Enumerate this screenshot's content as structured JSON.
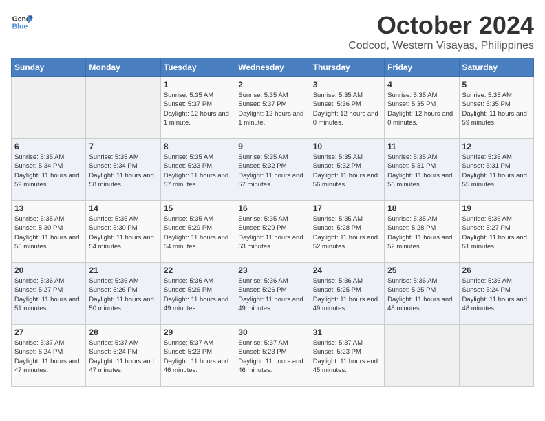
{
  "header": {
    "logo_line1": "General",
    "logo_line2": "Blue",
    "month": "October 2024",
    "location": "Codcod, Western Visayas, Philippines"
  },
  "days_of_week": [
    "Sunday",
    "Monday",
    "Tuesday",
    "Wednesday",
    "Thursday",
    "Friday",
    "Saturday"
  ],
  "weeks": [
    [
      {
        "day": "",
        "sunrise": "",
        "sunset": "",
        "daylight": "",
        "empty": true
      },
      {
        "day": "",
        "sunrise": "",
        "sunset": "",
        "daylight": "",
        "empty": true
      },
      {
        "day": "1",
        "sunrise": "Sunrise: 5:35 AM",
        "sunset": "Sunset: 5:37 PM",
        "daylight": "Daylight: 12 hours and 1 minute.",
        "empty": false
      },
      {
        "day": "2",
        "sunrise": "Sunrise: 5:35 AM",
        "sunset": "Sunset: 5:37 PM",
        "daylight": "Daylight: 12 hours and 1 minute.",
        "empty": false
      },
      {
        "day": "3",
        "sunrise": "Sunrise: 5:35 AM",
        "sunset": "Sunset: 5:36 PM",
        "daylight": "Daylight: 12 hours and 0 minutes.",
        "empty": false
      },
      {
        "day": "4",
        "sunrise": "Sunrise: 5:35 AM",
        "sunset": "Sunset: 5:35 PM",
        "daylight": "Daylight: 12 hours and 0 minutes.",
        "empty": false
      },
      {
        "day": "5",
        "sunrise": "Sunrise: 5:35 AM",
        "sunset": "Sunset: 5:35 PM",
        "daylight": "Daylight: 11 hours and 59 minutes.",
        "empty": false
      }
    ],
    [
      {
        "day": "6",
        "sunrise": "Sunrise: 5:35 AM",
        "sunset": "Sunset: 5:34 PM",
        "daylight": "Daylight: 11 hours and 59 minutes.",
        "empty": false
      },
      {
        "day": "7",
        "sunrise": "Sunrise: 5:35 AM",
        "sunset": "Sunset: 5:34 PM",
        "daylight": "Daylight: 11 hours and 58 minutes.",
        "empty": false
      },
      {
        "day": "8",
        "sunrise": "Sunrise: 5:35 AM",
        "sunset": "Sunset: 5:33 PM",
        "daylight": "Daylight: 11 hours and 57 minutes.",
        "empty": false
      },
      {
        "day": "9",
        "sunrise": "Sunrise: 5:35 AM",
        "sunset": "Sunset: 5:32 PM",
        "daylight": "Daylight: 11 hours and 57 minutes.",
        "empty": false
      },
      {
        "day": "10",
        "sunrise": "Sunrise: 5:35 AM",
        "sunset": "Sunset: 5:32 PM",
        "daylight": "Daylight: 11 hours and 56 minutes.",
        "empty": false
      },
      {
        "day": "11",
        "sunrise": "Sunrise: 5:35 AM",
        "sunset": "Sunset: 5:31 PM",
        "daylight": "Daylight: 11 hours and 56 minutes.",
        "empty": false
      },
      {
        "day": "12",
        "sunrise": "Sunrise: 5:35 AM",
        "sunset": "Sunset: 5:31 PM",
        "daylight": "Daylight: 11 hours and 55 minutes.",
        "empty": false
      }
    ],
    [
      {
        "day": "13",
        "sunrise": "Sunrise: 5:35 AM",
        "sunset": "Sunset: 5:30 PM",
        "daylight": "Daylight: 11 hours and 55 minutes.",
        "empty": false
      },
      {
        "day": "14",
        "sunrise": "Sunrise: 5:35 AM",
        "sunset": "Sunset: 5:30 PM",
        "daylight": "Daylight: 11 hours and 54 minutes.",
        "empty": false
      },
      {
        "day": "15",
        "sunrise": "Sunrise: 5:35 AM",
        "sunset": "Sunset: 5:29 PM",
        "daylight": "Daylight: 11 hours and 54 minutes.",
        "empty": false
      },
      {
        "day": "16",
        "sunrise": "Sunrise: 5:35 AM",
        "sunset": "Sunset: 5:29 PM",
        "daylight": "Daylight: 11 hours and 53 minutes.",
        "empty": false
      },
      {
        "day": "17",
        "sunrise": "Sunrise: 5:35 AM",
        "sunset": "Sunset: 5:28 PM",
        "daylight": "Daylight: 11 hours and 52 minutes.",
        "empty": false
      },
      {
        "day": "18",
        "sunrise": "Sunrise: 5:35 AM",
        "sunset": "Sunset: 5:28 PM",
        "daylight": "Daylight: 11 hours and 52 minutes.",
        "empty": false
      },
      {
        "day": "19",
        "sunrise": "Sunrise: 5:36 AM",
        "sunset": "Sunset: 5:27 PM",
        "daylight": "Daylight: 11 hours and 51 minutes.",
        "empty": false
      }
    ],
    [
      {
        "day": "20",
        "sunrise": "Sunrise: 5:36 AM",
        "sunset": "Sunset: 5:27 PM",
        "daylight": "Daylight: 11 hours and 51 minutes.",
        "empty": false
      },
      {
        "day": "21",
        "sunrise": "Sunrise: 5:36 AM",
        "sunset": "Sunset: 5:26 PM",
        "daylight": "Daylight: 11 hours and 50 minutes.",
        "empty": false
      },
      {
        "day": "22",
        "sunrise": "Sunrise: 5:36 AM",
        "sunset": "Sunset: 5:26 PM",
        "daylight": "Daylight: 11 hours and 49 minutes.",
        "empty": false
      },
      {
        "day": "23",
        "sunrise": "Sunrise: 5:36 AM",
        "sunset": "Sunset: 5:26 PM",
        "daylight": "Daylight: 11 hours and 49 minutes.",
        "empty": false
      },
      {
        "day": "24",
        "sunrise": "Sunrise: 5:36 AM",
        "sunset": "Sunset: 5:25 PM",
        "daylight": "Daylight: 11 hours and 49 minutes.",
        "empty": false
      },
      {
        "day": "25",
        "sunrise": "Sunrise: 5:36 AM",
        "sunset": "Sunset: 5:25 PM",
        "daylight": "Daylight: 11 hours and 48 minutes.",
        "empty": false
      },
      {
        "day": "26",
        "sunrise": "Sunrise: 5:36 AM",
        "sunset": "Sunset: 5:24 PM",
        "daylight": "Daylight: 11 hours and 48 minutes.",
        "empty": false
      }
    ],
    [
      {
        "day": "27",
        "sunrise": "Sunrise: 5:37 AM",
        "sunset": "Sunset: 5:24 PM",
        "daylight": "Daylight: 11 hours and 47 minutes.",
        "empty": false
      },
      {
        "day": "28",
        "sunrise": "Sunrise: 5:37 AM",
        "sunset": "Sunset: 5:24 PM",
        "daylight": "Daylight: 11 hours and 47 minutes.",
        "empty": false
      },
      {
        "day": "29",
        "sunrise": "Sunrise: 5:37 AM",
        "sunset": "Sunset: 5:23 PM",
        "daylight": "Daylight: 11 hours and 46 minutes.",
        "empty": false
      },
      {
        "day": "30",
        "sunrise": "Sunrise: 5:37 AM",
        "sunset": "Sunset: 5:23 PM",
        "daylight": "Daylight: 11 hours and 46 minutes.",
        "empty": false
      },
      {
        "day": "31",
        "sunrise": "Sunrise: 5:37 AM",
        "sunset": "Sunset: 5:23 PM",
        "daylight": "Daylight: 11 hours and 45 minutes.",
        "empty": false
      },
      {
        "day": "",
        "sunrise": "",
        "sunset": "",
        "daylight": "",
        "empty": true
      },
      {
        "day": "",
        "sunrise": "",
        "sunset": "",
        "daylight": "",
        "empty": true
      }
    ]
  ]
}
